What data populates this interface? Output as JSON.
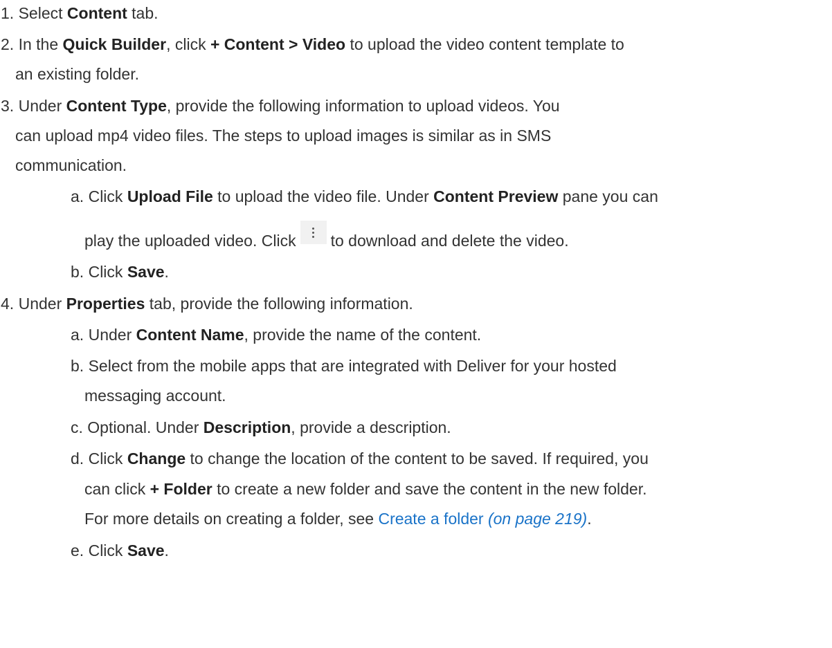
{
  "steps": [
    {
      "num": "1.",
      "pre": "Select ",
      "bold1": "Content",
      "post": " tab."
    },
    {
      "num": "2.",
      "pre": "In the ",
      "bold1": "Quick Builder",
      "mid": ", click ",
      "bold2": "+ Content > Video",
      "post": " to upload the video content template to",
      "cont": "an existing folder."
    },
    {
      "num": "3.",
      "pre": "Under ",
      "bold1": "Content Type",
      "post": ", provide the following information to upload videos. You",
      "cont1": "can upload mp4 video files. The steps to upload images is similar as in SMS",
      "cont2": "communication.",
      "substeps": [
        {
          "num": "a.",
          "pre": "Click ",
          "bold1": "Upload File",
          "mid": " to upload the video file. Under ",
          "bold2": "Content Preview",
          "post": " pane you can",
          "cont_pre": "play the uploaded video. Click",
          "cont_post": "to download and delete the video.",
          "icon": "kebab-menu-icon"
        },
        {
          "num": "b.",
          "pre": "Click ",
          "bold1": "Save",
          "post": "."
        }
      ]
    },
    {
      "num": "4.",
      "pre": "Under ",
      "bold1": "Properties",
      "post": " tab, provide the following information.",
      "substeps": [
        {
          "num": "a.",
          "pre": "Under ",
          "bold1": "Content Name",
          "post": ", provide the name of the content."
        },
        {
          "num": "b.",
          "text": "Select from the mobile apps that are integrated with Deliver for your hosted",
          "cont": "messaging account."
        },
        {
          "num": "c.",
          "pre": "Optional. Under ",
          "bold1": "Description",
          "post": ", provide a description."
        },
        {
          "num": "d.",
          "pre": "Click ",
          "bold1": "Change",
          "post": " to change the location of the content to be saved. If required, you",
          "cont1_pre": "can click ",
          "cont1_bold": "+ Folder",
          "cont1_post": " to create a new folder and save the content in the new folder.",
          "cont2_pre": "For more details on creating a folder, see ",
          "link_text": "Create a folder",
          "link_page": "(on page 219)",
          "cont2_post": "."
        },
        {
          "num": "e.",
          "pre": "Click ",
          "bold1": "Save",
          "post": "."
        }
      ]
    }
  ],
  "colors": {
    "text": "#333333",
    "link": "#1a73c8",
    "icon_bg": "#f1f1f1"
  }
}
